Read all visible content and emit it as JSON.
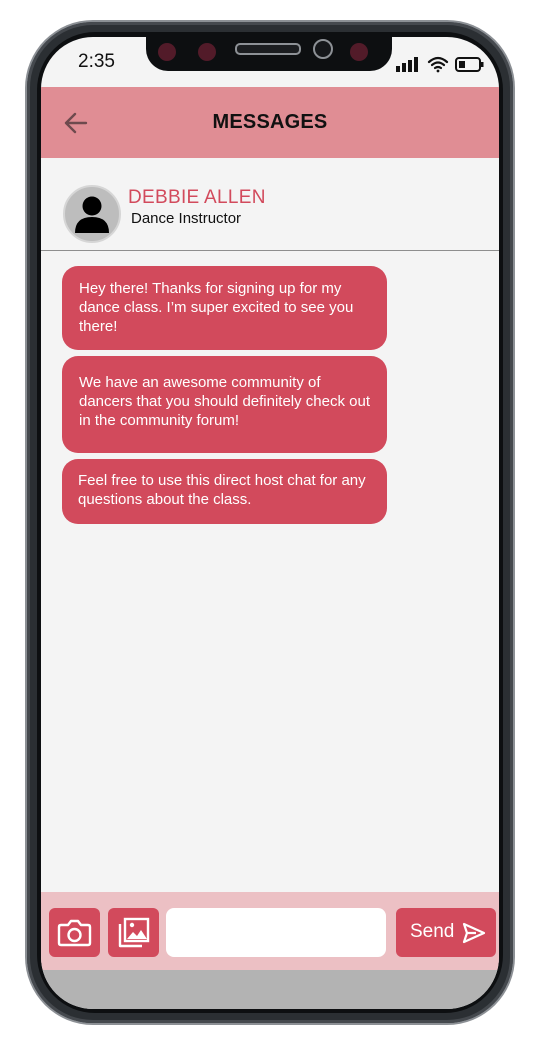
{
  "status_bar": {
    "time": "2:35",
    "icons": [
      "signal-icon",
      "wifi-icon",
      "battery-icon"
    ]
  },
  "app_bar": {
    "title": "MESSAGES",
    "back_icon": "arrow-left-icon"
  },
  "contact": {
    "name": "DEBBIE ALLEN",
    "role": "Dance Instructor",
    "avatar_icon": "user-silhouette-icon"
  },
  "messages": [
    {
      "text": "Hey there! Thanks for signing up for my dance class. I’m super excited to see you there!"
    },
    {
      "text": "We have an awesome community of dancers that you should definitely check out in the community forum!"
    },
    {
      "text": "Feel free to use this direct host chat for any questions about the class."
    }
  ],
  "composer": {
    "input_value": "",
    "input_placeholder": "",
    "send_label": "Send",
    "camera_icon": "camera-icon",
    "gallery_icon": "image-gallery-icon",
    "send_icon": "paper-plane-icon"
  },
  "colors": {
    "accent": "#d24a5c",
    "app_bar": "#e08d94",
    "composer_bg": "#ecc0c4",
    "screen_bg": "#f4f4f4"
  }
}
